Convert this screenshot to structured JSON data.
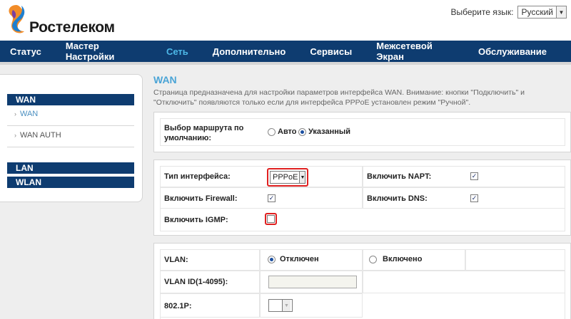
{
  "header": {
    "brand": "Ростелеком",
    "lang_label": "Выберите язык:",
    "lang_value": "Русский"
  },
  "nav": {
    "items": [
      "Статус",
      "Мастер Настройки",
      "Сеть",
      "Дополнительно",
      "Сервисы",
      "Межсетевой Экран",
      "Обслуживание"
    ],
    "active": "Сеть"
  },
  "sidebar": {
    "group1": "WAN",
    "link_wan": "WAN",
    "link_wan_auth": "WAN AUTH",
    "group2": "LAN",
    "group3": "WLAN"
  },
  "main": {
    "title": "WAN",
    "description": "Страница предназначена для настройки параметров интерфейса WAN. Внимание: кнопки \"Подключить\" и \"Отключить\" появляются только если для интерфейса PPPoE установлен режим \"Ручной\".",
    "route_label": "Выбор маршрута по умолчанию:",
    "route_auto": "Авто",
    "route_manual": "Указанный",
    "iface_label": "Тип интерфейса:",
    "iface_value": "PPPoE",
    "napt_label": "Включить NAPT:",
    "firewall_label": "Включить Firewall:",
    "dns_label": "Включить DNS:",
    "igmp_label": "Включить IGMP:",
    "vlan_label": "VLAN:",
    "vlan_off": "Отключен",
    "vlan_on": "Включено",
    "vlan_id_label": "VLAN ID(1-4095):",
    "dot1p_label": "802.1P:"
  },
  "colors": {
    "nav_bg": "#0e3c70",
    "nav_active": "#4db8e8",
    "highlight": "#e02020"
  }
}
